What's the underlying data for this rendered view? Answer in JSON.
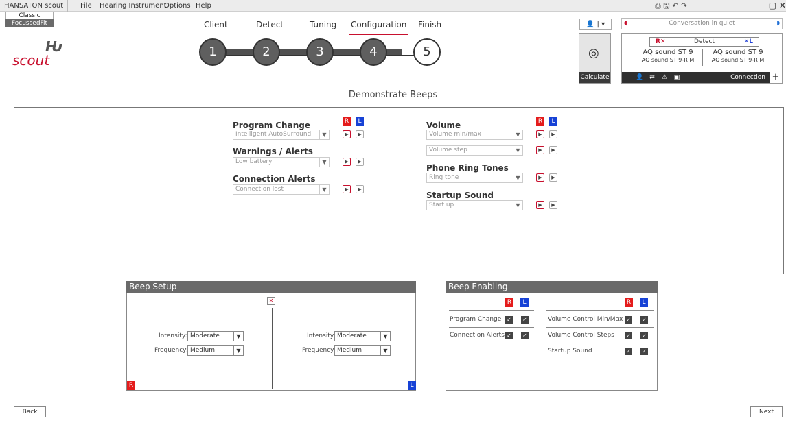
{
  "menubar": {
    "app_name": "HANSATON scout",
    "items": [
      "File",
      "Hearing Instrument",
      "Options",
      "Help"
    ],
    "window_controls": "_ ▢ ✕"
  },
  "mode": {
    "classic": "Classic",
    "focussed": "FocussedFit"
  },
  "logo": {
    "word": "scout"
  },
  "workflow": {
    "tabs": [
      "Client",
      "Detect",
      "Tuning",
      "Configuration",
      "Finish"
    ],
    "active_tab": "Configuration",
    "steps": [
      "1",
      "2",
      "3",
      "4",
      "5"
    ]
  },
  "header": {
    "calculate": "Calculate",
    "program": "Conversation in quiet",
    "detect": "Detect",
    "right_device": "AQ sound ST 9",
    "right_device_sub": "AQ sound ST 9-R M",
    "left_device": "AQ sound ST 9",
    "left_device_sub": "AQ sound ST 9-R M",
    "connection": "Connection"
  },
  "page_title": "Demonstrate Beeps",
  "demonstrate": {
    "side_r": "R",
    "side_l": "L",
    "program_change": {
      "title": "Program Change",
      "value": "Intelligent AutoSurround"
    },
    "warnings": {
      "title": "Warnings / Alerts",
      "value": "Low battery"
    },
    "connection_alerts": {
      "title": "Connection Alerts",
      "value": "Connection lost"
    },
    "volume": {
      "title": "Volume",
      "value1": "Volume min/max",
      "value2": "Volume step"
    },
    "phone": {
      "title": "Phone Ring Tones",
      "value": "Ring tone"
    },
    "startup": {
      "title": "Startup Sound",
      "value": "Start up"
    }
  },
  "beep_setup": {
    "title": "Beep Setup",
    "intensity_label": "Intensity:",
    "frequency_label": "Frequency:",
    "right": {
      "intensity": "Moderate",
      "frequency": "Medium"
    },
    "left": {
      "intensity": "Moderate",
      "frequency": "Medium"
    },
    "side_r": "R",
    "side_l": "L"
  },
  "beep_enabling": {
    "title": "Beep Enabling",
    "side_r": "R",
    "side_l": "L",
    "left_col": [
      "Program Change",
      "Connection Alerts"
    ],
    "right_col": [
      "Volume Control Min/Max",
      "Volume Control Steps",
      "Startup Sound"
    ]
  },
  "nav": {
    "back": "Back",
    "next": "Next"
  }
}
